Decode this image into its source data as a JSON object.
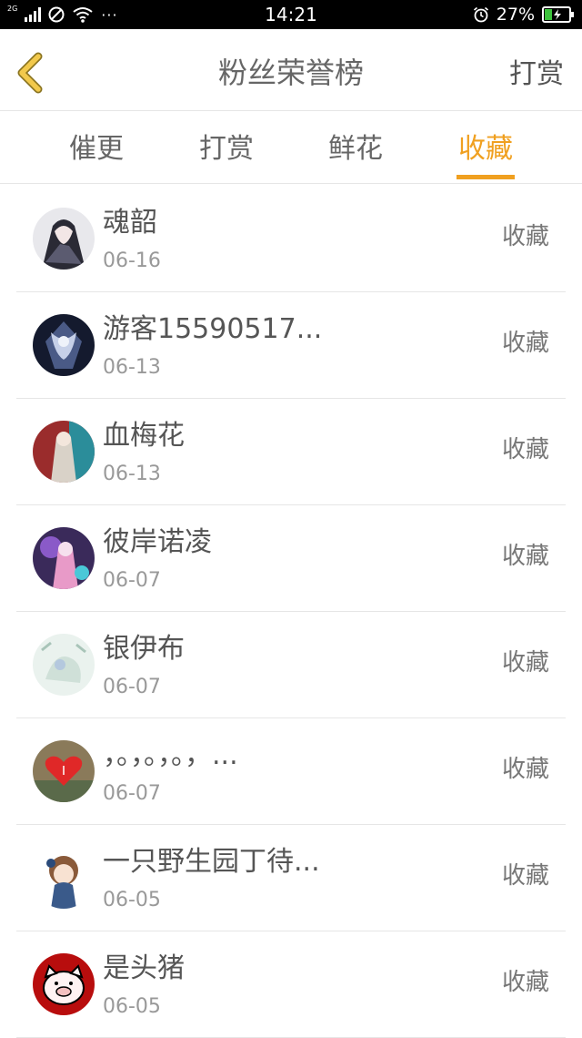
{
  "status": {
    "network": "2G",
    "time": "14:21",
    "battery": "27%",
    "more": "···"
  },
  "header": {
    "title": "粉丝荣誉榜",
    "reward": "打赏"
  },
  "tabs": [
    {
      "label": "催更"
    },
    {
      "label": "打赏"
    },
    {
      "label": "鲜花"
    },
    {
      "label": "收藏",
      "active": true
    }
  ],
  "list": [
    {
      "name": "魂韶",
      "date": "06-16",
      "action": "收藏"
    },
    {
      "name": "游客15590517...",
      "date": "06-13",
      "action": "收藏"
    },
    {
      "name": "血梅花",
      "date": "06-13",
      "action": "收藏"
    },
    {
      "name": "彼岸诺凌",
      "date": "06-07",
      "action": "收藏"
    },
    {
      "name": "银伊布",
      "date": "06-07",
      "action": "收藏"
    },
    {
      "name": "，。，。，。，...",
      "date": "06-07",
      "action": "收藏"
    },
    {
      "name": "一只野生园丁待...",
      "date": "06-05",
      "action": "收藏"
    },
    {
      "name": "是头猪",
      "date": "06-05",
      "action": "收藏"
    }
  ],
  "colors": {
    "accent": "#f0a020",
    "back_arrow": "#f2c94c"
  }
}
